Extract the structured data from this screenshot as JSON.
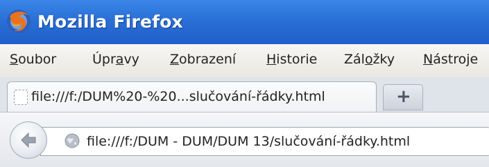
{
  "window": {
    "title": "Mozilla Firefox",
    "logo_icon": "firefox-logo-icon"
  },
  "menu": {
    "items": [
      {
        "pre": "",
        "u": "S",
        "post": "oubor"
      },
      {
        "pre": "Úpr",
        "u": "a",
        "post": "vy"
      },
      {
        "pre": "",
        "u": "Z",
        "post": "obrazení"
      },
      {
        "pre": "",
        "u": "H",
        "post": "istorie"
      },
      {
        "pre": "Zál",
        "u": "o",
        "post": "žky"
      },
      {
        "pre": "",
        "u": "N",
        "post": "ástroje"
      }
    ]
  },
  "tabs": [
    {
      "title": "file:///f:/DUM%20-%20...slučování-řádky.html",
      "icon": "blank-page-icon"
    }
  ],
  "newtab": {
    "label": "+"
  },
  "navbar": {
    "back_icon": "back-arrow-icon",
    "site_icon": "globe-icon",
    "url": "file:///f:/DUM - DUM/DUM 13/slučování-řádky.html"
  },
  "colors": {
    "titlebar": "#2a6fd6",
    "title_text": "#ffffff"
  }
}
